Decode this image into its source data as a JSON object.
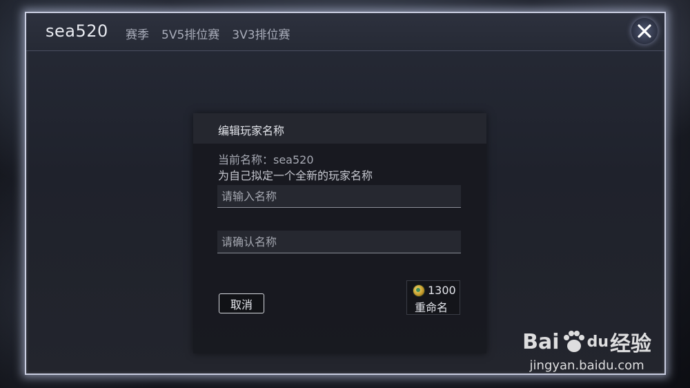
{
  "header": {
    "player_name": "sea520",
    "tabs": [
      {
        "label": "赛季"
      },
      {
        "label": "5V5排位赛"
      },
      {
        "label": "3V3排位赛"
      }
    ],
    "close_icon": "close-icon"
  },
  "dialog": {
    "title": "编辑玩家名称",
    "current_name": "当前名称：sea520",
    "hint": "为自己拟定一个全新的玩家名称",
    "name_input": {
      "value": "",
      "placeholder": "请输入名称"
    },
    "confirm_input": {
      "value": "",
      "placeholder": "请确认名称"
    },
    "cancel_label": "取消",
    "rename": {
      "cost": "1300",
      "label": "重命名",
      "currency_icon": "coin-icon"
    }
  },
  "watermark": {
    "brand": "Bai",
    "brand_suffix": "du",
    "brand_cn": "经验",
    "url": "jingyan.baidu.com"
  },
  "colors": {
    "modal_border": "#c9cde0",
    "dialog_bg": "#18191f",
    "text_primary": "#e8eaf0"
  }
}
